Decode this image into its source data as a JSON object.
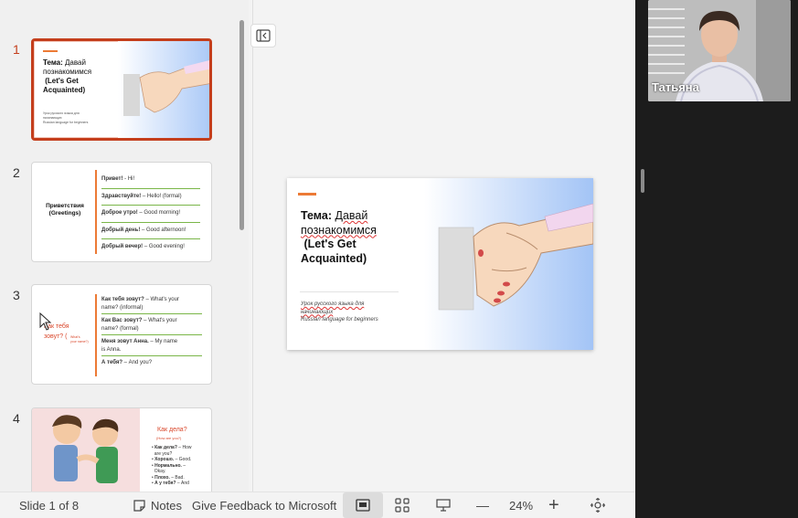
{
  "slides": [
    {
      "number": "1",
      "title_bold": "Тема:",
      "title_rest": "Давай",
      "title_line2": "познакомимся",
      "title_line3": "(Let's Get",
      "title_line4": "Acquainted)",
      "footer_line1": "Урок русского языка для",
      "footer_line2": "начинающих",
      "footer_line3": "Russian language for beginners"
    },
    {
      "number": "2",
      "heading": "Приветствия",
      "heading_sub": "(Greetings)",
      "items": [
        {
          "ru": "Привет!",
          "en": " - Hi!"
        },
        {
          "ru": "Здравствуйте!",
          "en": " – Hello! (formal)"
        },
        {
          "ru": "Доброе утро!",
          "en": " – Good morning!"
        },
        {
          "ru": "Добрый день!",
          "en": " – Good afternoon!"
        },
        {
          "ru": "Добрый вечер!",
          "en": " – Good evening!"
        }
      ]
    },
    {
      "number": "3",
      "side_line1": "Как тебя",
      "side_line2": "зовут? (",
      "side_small1": "What's",
      "side_small2": "your name?)",
      "items": [
        {
          "ru": "Как тебя зовут?",
          "en": " – What's your",
          "en2": "name? (informal)"
        },
        {
          "ru": "Как Вас зовут?",
          "en": " – What's your",
          "en2": "name? (formal)"
        },
        {
          "ru": "Меня зовут Анна.",
          "en": " – My name",
          "en2": "is Anna."
        },
        {
          "ru": "А тебя?",
          "en": " – And you?",
          "en2": ""
        }
      ]
    },
    {
      "number": "4",
      "heading": "Как дела?",
      "heading_sub": "(How are you?)",
      "items": [
        {
          "ru": "Как дела?",
          "en": " – How",
          "en2": "are you?"
        },
        {
          "ru": "Хорошо.",
          "en": " – Good.",
          "en2": ""
        },
        {
          "ru": "Нормально.",
          "en": " –",
          "en2": "Okay."
        },
        {
          "ru": "Плохо.",
          "en": " – Bad.",
          "en2": ""
        },
        {
          "ru": "А у тебя?",
          "en": " – And",
          "en2": ""
        }
      ]
    }
  ],
  "status": {
    "slide_counter": "Slide 1 of 8",
    "notes_label": "Notes",
    "feedback_label": "Give Feedback to Microsoft",
    "zoom_minus": "—",
    "zoom_level": "24%",
    "zoom_plus": "+"
  },
  "call": {
    "participant_name": "Татьяна"
  },
  "colors": {
    "accent": "#c43e1c",
    "orange_bar": "#ec7a35",
    "green_rule": "#7ab648",
    "red_heading": "#d9472b"
  },
  "icons": {
    "collapse": "panel-collapse-icon",
    "notes": "notes-icon",
    "normal_view": "normal-view-icon",
    "sorter_view": "slide-sorter-icon",
    "presenter_view": "presenter-view-icon",
    "fit": "fit-to-window-icon"
  }
}
